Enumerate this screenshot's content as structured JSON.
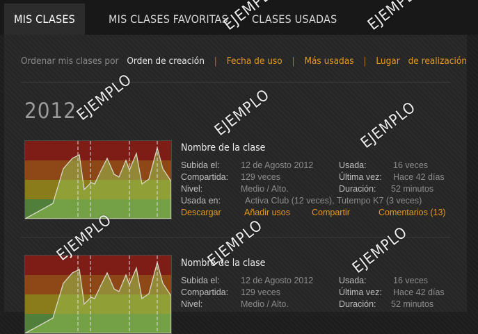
{
  "tabs": [
    {
      "label": "MIS CLASES"
    },
    {
      "label": "MIS CLASES FAVORITAS"
    },
    {
      "label": "CLASES USADAS"
    }
  ],
  "sort": {
    "label": "Ordenar mis clases por",
    "active": "Orden de creación",
    "options": [
      "Fecha de uso",
      "Más usadas",
      "Lugar",
      "de realización"
    ]
  },
  "watermark": "EJEMPLO",
  "year": "2012",
  "colors": {
    "accent": "#e59a1c",
    "band_red": "#8c1e16",
    "band_orange": "#9b4a18",
    "band_yellow": "#9c8b1e",
    "band_green": "#5e9a45"
  },
  "classes": [
    {
      "title": "Nombre de la clase",
      "uploaded_label": "Subida el:",
      "uploaded": "12 de Agosto 2012",
      "shared_label": "Compartida:",
      "shared": "129 veces",
      "level_label": "Nivel:",
      "level": "Medio / Alto.",
      "used_in_label": "Usada en:",
      "used_in": "Activa Club (12 veces), Tutempo K7 (3 veces)",
      "used_label": "Usada:",
      "used": "16 veces",
      "last_label": "Última vez:",
      "last": "Hace 42 días",
      "duration_label": "Duración:",
      "duration": "52 minutos",
      "actions": {
        "download": "Descargar",
        "add_uses": "Añadir usos",
        "share": "Compartir",
        "comments": "Comentarios (13)"
      }
    },
    {
      "title": "Nombre de la clase",
      "uploaded_label": "Subida el:",
      "uploaded": "12 de Agosto 2012",
      "shared_label": "Compartida:",
      "shared": "129 veces",
      "level_label": "Nivel:",
      "level": "Medio / Alto.",
      "used_label": "Usada:",
      "used": "16 veces",
      "last_label": "Última vez:",
      "last": "Hace 42 días",
      "duration_label": "Duración:",
      "duration": "52 minutos"
    }
  ]
}
